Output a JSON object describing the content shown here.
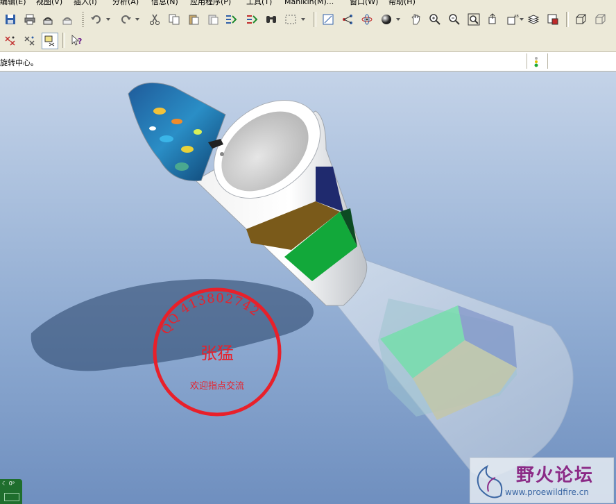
{
  "menu": {
    "items": [
      "编辑(E)",
      "视图(V)",
      "插入(I)",
      "分析(A)",
      "信息(N)",
      "应用程序(P)",
      "工具(T)",
      "Manikin(M)...",
      "窗口(W)",
      "帮助(H)"
    ]
  },
  "message_bar": {
    "text": "旋转中心。"
  },
  "stamp": {
    "qq": "QQ 413802742",
    "name": "张猛",
    "motto": "欢迎指点交流"
  },
  "watermark": {
    "title": "野火论坛",
    "url": "www.proewildfire.cn"
  },
  "corner_widget": {
    "label": "☾ 0⁹"
  },
  "colors": {
    "toolbar_bg": "#ece9d8",
    "viewport_top": "#c4d3e8",
    "viewport_bottom": "#6f8fbf",
    "stamp_red": "#e8202a",
    "watermark_purple": "#8b2a86"
  },
  "icons": {
    "toolbar_row1": [
      "save-icon",
      "print-icon",
      "send-mail-icon",
      "send-mail-alt-icon",
      "undo-icon",
      "redo-icon",
      "cut-icon",
      "copy-icon",
      "paste-icon",
      "paste-special-icon",
      "regenerate-icon",
      "regenerate-manager-icon",
      "find-icon",
      "select-box-icon",
      "orient-icon",
      "datum-axis-icon",
      "spin-center-icon",
      "shading-icon",
      "pan-icon",
      "zoom-in-icon",
      "zoom-out-icon",
      "refit-icon",
      "reorient-icon",
      "named-view-icon",
      "layers-icon",
      "view-manager-icon",
      "wireframe-icon",
      "hidden-line-icon"
    ],
    "toolbar_row2": [
      "datum-planes-icon",
      "datum-axes-icon",
      "datum-points-icon",
      "context-help-icon"
    ]
  }
}
